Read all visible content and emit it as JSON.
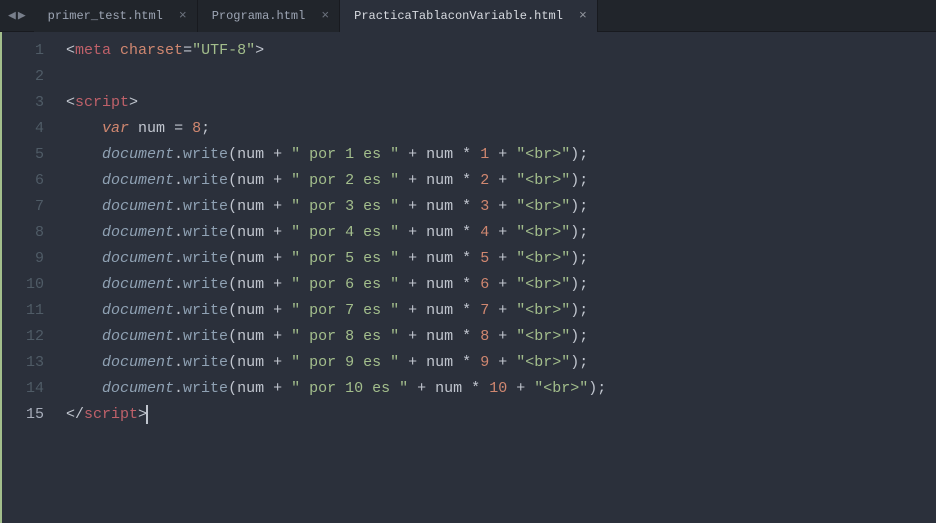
{
  "nav": {
    "back": "◀",
    "forward": "▶"
  },
  "tabs": [
    {
      "label": "primer_test.html",
      "active": false
    },
    {
      "label": "Programa.html",
      "active": false
    },
    {
      "label": "PracticaTablaconVariable.html",
      "active": true
    }
  ],
  "lineNumbers": [
    "1",
    "2",
    "3",
    "4",
    "5",
    "6",
    "7",
    "8",
    "9",
    "10",
    "11",
    "12",
    "13",
    "14",
    "15"
  ],
  "currentLine": 15,
  "code": {
    "metaTag": "meta",
    "charsetAttr": "charset",
    "charsetVal": "\"UTF-8\"",
    "scriptTag": "script",
    "varKw": "var",
    "varName": "num",
    "varVal": "8",
    "obj": "document",
    "method": "write",
    "argIdent": "num",
    "rows": [
      {
        "mid": "\" por 1 es \"",
        "mult": "1",
        "tail": "\"<br>\""
      },
      {
        "mid": "\" por 2 es \"",
        "mult": "2",
        "tail": "\"<br>\""
      },
      {
        "mid": "\" por 3 es \"",
        "mult": "3",
        "tail": "\"<br>\""
      },
      {
        "mid": "\" por 4 es \"",
        "mult": "4",
        "tail": "\"<br>\""
      },
      {
        "mid": "\" por 5 es \"",
        "mult": "5",
        "tail": "\"<br>\""
      },
      {
        "mid": "\" por 6 es \"",
        "mult": "6",
        "tail": "\"<br>\""
      },
      {
        "mid": "\" por 7 es \"",
        "mult": "7",
        "tail": "\"<br>\""
      },
      {
        "mid": "\" por 8 es \"",
        "mult": "8",
        "tail": "\"<br>\""
      },
      {
        "mid": "\" por 9 es \"",
        "mult": "9",
        "tail": "\"<br>\""
      },
      {
        "mid": "\" por 10 es \"",
        "mult": "10",
        "tail": "\"<br>\""
      }
    ]
  }
}
